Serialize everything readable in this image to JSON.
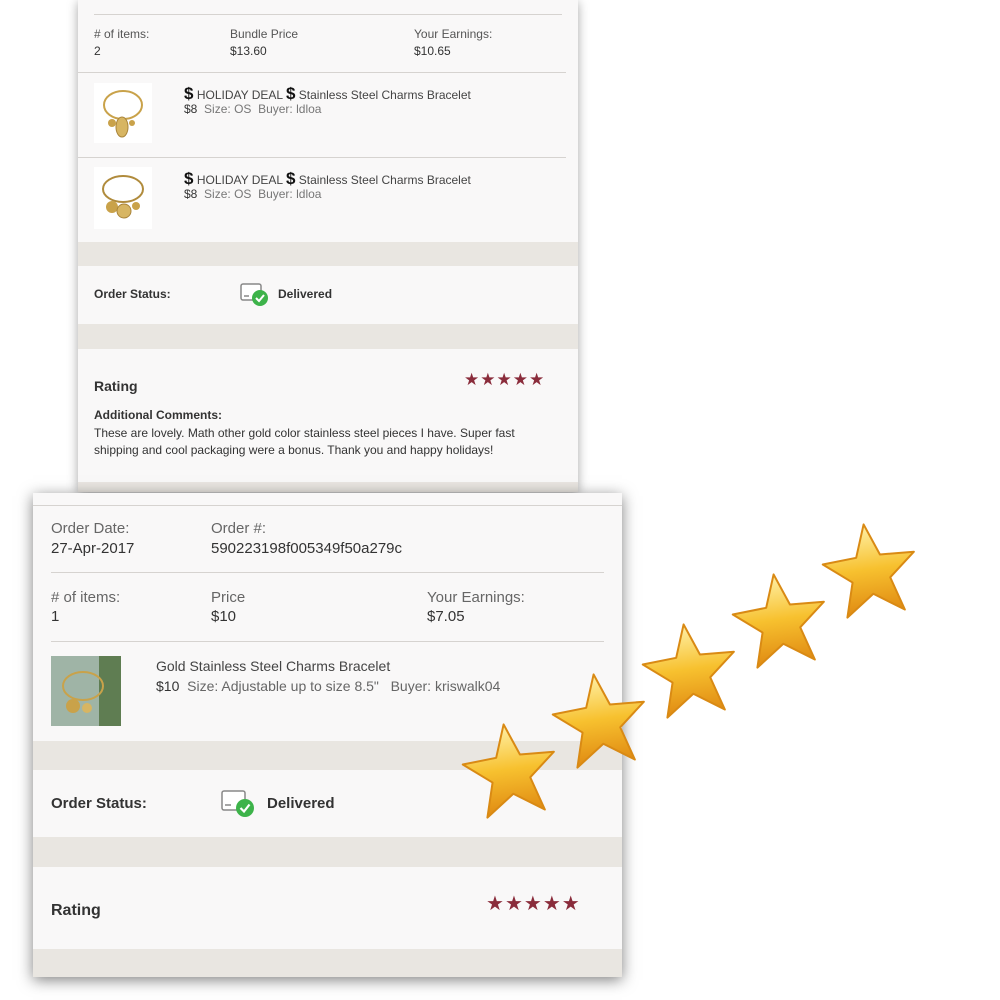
{
  "top_card": {
    "items_label": "# of items:",
    "items_value": "2",
    "price_label": "Bundle Price",
    "price_value": "$13.60",
    "earnings_label": "Your Earnings:",
    "earnings_value": "$10.65",
    "listings": [
      {
        "dollar_icon": "$",
        "tag": "HOLIDAY DEAL",
        "title": "Stainless Steel Charms Bracelet",
        "price": "$8",
        "size_label": "Size:",
        "size": "OS",
        "buyer_label": "Buyer:",
        "buyer": "ldloa"
      },
      {
        "dollar_icon": "$",
        "tag": "HOLIDAY DEAL",
        "title": "Stainless Steel Charms Bracelet",
        "price": "$8",
        "size_label": "Size:",
        "size": "OS",
        "buyer_label": "Buyer:",
        "buyer": "ldloa"
      }
    ],
    "status_label": "Order Status:",
    "status_value": "Delivered",
    "rating_label": "Rating",
    "rating_stars": 5,
    "comments_label": "Additional Comments:",
    "comments_line1": "These are lovely. Math other gold color stainless steel pieces I have. Super fast",
    "comments_line2": "shipping and cool packaging were a bonus. Thank you and happy holidays!"
  },
  "bottom_card": {
    "date_label": "Order Date:",
    "date_value": "27-Apr-2017",
    "order_label": "Order #:",
    "order_value": "590223198f005349f50a279c",
    "items_label": "# of items:",
    "items_value": "1",
    "price_label": "Price",
    "price_value": "$10",
    "earnings_label": "Your Earnings:",
    "earnings_value": "$7.05",
    "listing": {
      "title": "Gold Stainless Steel Charms Bracelet",
      "price": "$10",
      "size_label": "Size:",
      "size": "Adjustable up to size 8.5\"",
      "buyer_label": "Buyer:",
      "buyer": "kriswalk04"
    },
    "status_label": "Order Status:",
    "status_value": "Delivered",
    "rating_label": "Rating",
    "rating_stars": 5
  },
  "star_char": "★",
  "colors": {
    "rating_star": "#8a2c3b",
    "band": "#e9e6e1",
    "delivered_check": "#3db34a",
    "sticker_star": "#f7c12f"
  }
}
